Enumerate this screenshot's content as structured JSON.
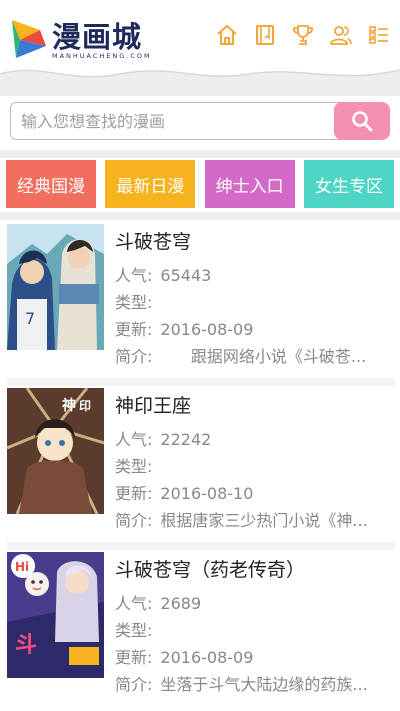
{
  "header": {
    "logo_text": "漫画城",
    "logo_sub": "MANHUACHENG.COM",
    "nav": [
      {
        "icon": "home-icon"
      },
      {
        "icon": "book-icon"
      },
      {
        "icon": "trophy-icon"
      },
      {
        "icon": "user-icon"
      },
      {
        "icon": "menu-icon"
      }
    ]
  },
  "search": {
    "placeholder": "输入您想查找的漫画",
    "icon": "search-icon"
  },
  "categories": [
    {
      "label": "经典国漫",
      "color": "#f26e5f"
    },
    {
      "label": "最新日漫",
      "color": "#f7b21d"
    },
    {
      "label": "绅士入口",
      "color": "#d46ac7"
    },
    {
      "label": "女生专区",
      "color": "#4ed5c6"
    }
  ],
  "comics": [
    {
      "title": "斗破苍穹",
      "popularity_label": "人气:",
      "popularity": "65443",
      "type_label": "类型:",
      "type": "",
      "updated_label": "更新:",
      "updated": "2016-08-09",
      "summary_label": "简介:",
      "summary": "      跟据网络小说《斗破苍..."
    },
    {
      "title": "神印王座",
      "popularity_label": "人气:",
      "popularity": "22242",
      "type_label": "类型:",
      "type": "",
      "updated_label": "更新:",
      "updated": "2016-08-10",
      "summary_label": "简介:",
      "summary": "根据唐家三少热门小说《神..."
    },
    {
      "title": "斗破苍穹（药老传奇）",
      "popularity_label": "人气:",
      "popularity": "2689",
      "type_label": "类型:",
      "type": "",
      "updated_label": "更新:",
      "updated": "2016-08-09",
      "summary_label": "简介:",
      "summary": "坐落于斗气大陆边缘的药族..."
    }
  ],
  "colors": {
    "search_button": "#f38fb1",
    "icon_orange": "#f0a63a"
  }
}
